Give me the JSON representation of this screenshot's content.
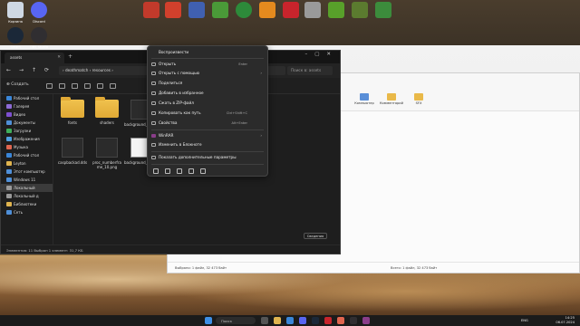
{
  "desktop": {
    "icons_top": [
      {
        "label": "Корзина",
        "color": "#cfd8e3"
      },
      {
        "label": "Discord",
        "color": "#5865f2"
      },
      {
        "label": "Steam",
        "color": "#1b2838"
      },
      {
        "label": "OBS Studio",
        "color": "#302e31"
      },
      {
        "label": "",
        "color": "#c23a2b"
      },
      {
        "label": "",
        "color": "#d1402c"
      },
      {
        "label": "",
        "color": "#4060b0"
      },
      {
        "label": "",
        "color": "#4a9a38"
      },
      {
        "label": "",
        "color": "#2d8a3a"
      },
      {
        "label": "",
        "color": "#e48a1e"
      },
      {
        "label": "",
        "color": "#c8242c"
      },
      {
        "label": "",
        "color": "#9a9a9a"
      },
      {
        "label": "",
        "color": "#58a02a"
      },
      {
        "label": "",
        "color": "#5b7b2f"
      },
      {
        "label": "",
        "color": "#3c8c3c"
      }
    ]
  },
  "explorer": {
    "tab_title": "assets",
    "address": "›  deathmatch  ›  resources  ›",
    "search_placeholder": "Поиск в: assets",
    "create_label": "Создать",
    "sidebar": [
      {
        "label": "Рабочий стол",
        "color": "#3a86d8"
      },
      {
        "label": "Галерея",
        "color": "#8d6bd6"
      },
      {
        "label": "Видео",
        "color": "#7d4fd0"
      },
      {
        "label": "Документы",
        "color": "#4f8fd8"
      },
      {
        "label": "Загрузки",
        "color": "#3fae5a"
      },
      {
        "label": "Изображения",
        "color": "#4f9fe0"
      },
      {
        "label": "Музыка",
        "color": "#e0654f"
      },
      {
        "label": "Рабочий стол",
        "color": "#3a86d8"
      },
      {
        "label": "Leyton",
        "color": "#e0b44f"
      },
      {
        "label": "Этот компьютер",
        "color": "#4f8fd8"
      },
      {
        "label": "Windows 11",
        "color": "#4f8fd8"
      },
      {
        "label": "Локальный",
        "color": "#999999"
      },
      {
        "label": "Локальный д",
        "color": "#999999"
      },
      {
        "label": "Библиотеки",
        "color": "#e0b44f"
      },
      {
        "label": "Сеть",
        "color": "#4f8fd8"
      }
    ],
    "files": [
      {
        "name": "fonts",
        "kind": "folder"
      },
      {
        "name": "shaders",
        "kind": "folder"
      },
      {
        "name": "background_g...d.dds",
        "kind": "doc"
      },
      {
        "name": "caspbackad.dds",
        "kind": "doc"
      },
      {
        "name": "proc_numberfra me_10.png",
        "kind": "doc"
      },
      {
        "name": "background_...ult.dds",
        "kind": "doc-light"
      }
    ],
    "status": "Элементов: 11    Выбран 1 элемент: 31,7 КБ",
    "details_label": "Сведения"
  },
  "second_window": {
    "toolbar_items": [
      "Компьютер",
      "Комментарий",
      "SFX"
    ],
    "files": [
      "background_poli ca.dds",
      "background_poli cabba.dds"
    ],
    "selected_tile_label": "RUS",
    "status_left": "Выбрано: 1 файл, 32 473 байт",
    "status_right": "Всего: 1 файл, 32 473 байт"
  },
  "context_menu": {
    "items": [
      {
        "label": "Воспроизвести",
        "shortcut": "",
        "arrow": false
      },
      {
        "label": "Открыть",
        "shortcut": "Enter",
        "arrow": false
      },
      {
        "label": "Открыть с помощью",
        "shortcut": "",
        "arrow": true
      },
      {
        "label": "Поделиться",
        "shortcut": "",
        "arrow": false
      },
      {
        "label": "Добавить в избранное",
        "shortcut": "",
        "arrow": false
      },
      {
        "label": "Сжать в ZIP-файл",
        "shortcut": "",
        "arrow": false
      },
      {
        "label": "Копировать как путь",
        "shortcut": "Ctrl+Shift+C",
        "arrow": false
      },
      {
        "label": "Свойства",
        "shortcut": "Alt+Enter",
        "arrow": false
      },
      {
        "label": "WinRAR",
        "shortcut": "",
        "arrow": true
      },
      {
        "label": "Изменить в Блокноте",
        "shortcut": "",
        "arrow": false
      },
      {
        "label": "Показать дополнительные параметры",
        "shortcut": "",
        "arrow": false
      }
    ]
  },
  "taskbar": {
    "search_label": "Поиск",
    "lang": "ENG",
    "time": "14:25",
    "date": "06.07.2024"
  }
}
